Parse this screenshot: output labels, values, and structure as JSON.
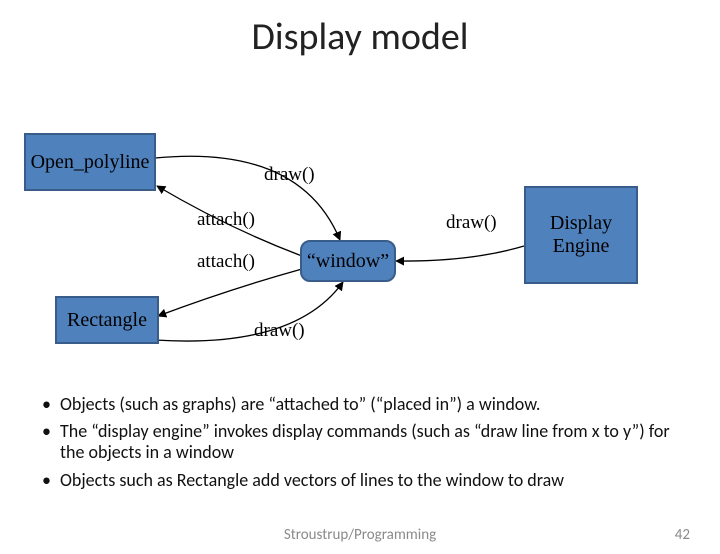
{
  "title": "Display model",
  "nodes": {
    "open_polyline": "Open_polyline",
    "rectangle": "Rectangle",
    "window": "“window”",
    "display_engine": "Display Engine"
  },
  "edge_labels": {
    "attach1": "attach()",
    "attach2": "attach()",
    "draw_top": "draw()",
    "draw_bottom": "draw()",
    "draw_right": "draw()"
  },
  "bullets": [
    "Objects (such as graphs) are “attached to” (“placed in”) a window.",
    "The “display engine” invokes  display commands (such as “draw line from x to y”) for the objects in a window",
    "Objects such as Rectangle add vectors of lines to the window to draw"
  ],
  "footer": "Stroustrup/Programming",
  "page_number": "42"
}
